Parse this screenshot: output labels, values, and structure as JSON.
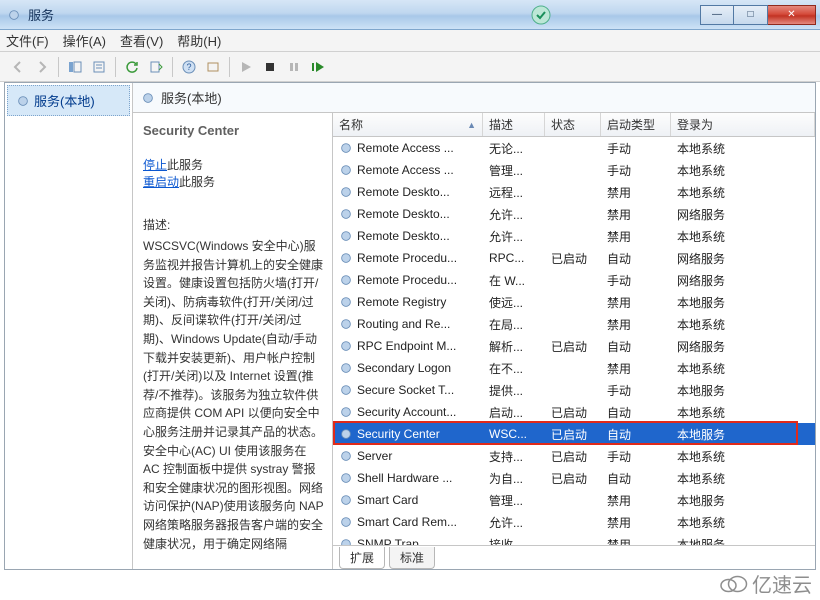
{
  "window": {
    "title": "服务",
    "buttons": {
      "min": "—",
      "max": "□",
      "close": "✕"
    }
  },
  "menu": {
    "file": "文件(F)",
    "action": "操作(A)",
    "view": "查看(V)",
    "help": "帮助(H)"
  },
  "tree": {
    "root_label": "服务(本地)"
  },
  "right_header": {
    "title": "服务(本地)"
  },
  "details": {
    "service_name": "Security Center",
    "stop_link": "停止",
    "stop_tail": "此服务",
    "restart_link": "重启动",
    "restart_tail": "此服务",
    "desc_label": "描述:",
    "desc_text": "WSCSVC(Windows 安全中心)服务监视并报告计算机上的安全健康设置。健康设置包括防火墙(打开/关闭)、防病毒软件(打开/关闭/过期)、反间谍软件(打开/关闭/过期)、Windows Update(自动/手动下载并安装更新)、用户帐户控制(打开/关闭)以及 Internet 设置(推荐/不推荐)。该服务为独立软件供应商提供 COM API 以便向安全中心服务注册并记录其产品的状态。安全中心(AC) UI 使用该服务在 AC 控制面板中提供 systray 警报和安全健康状况的图形视图。网络访问保护(NAP)使用该服务向 NAP 网络策略服务器报告客户端的安全健康状况，用于确定网络隔"
  },
  "list": {
    "columns": {
      "name": "名称",
      "desc": "描述",
      "state": "状态",
      "start": "启动类型",
      "logon": "登录为"
    },
    "rows": [
      {
        "name": "Remote Access ...",
        "desc": "无论...",
        "state": "",
        "start": "手动",
        "logon": "本地系统"
      },
      {
        "name": "Remote Access ...",
        "desc": "管理...",
        "state": "",
        "start": "手动",
        "logon": "本地系统"
      },
      {
        "name": "Remote Deskto...",
        "desc": "远程...",
        "state": "",
        "start": "禁用",
        "logon": "本地系统"
      },
      {
        "name": "Remote Deskto...",
        "desc": "允许...",
        "state": "",
        "start": "禁用",
        "logon": "网络服务"
      },
      {
        "name": "Remote Deskto...",
        "desc": "允许...",
        "state": "",
        "start": "禁用",
        "logon": "本地系统"
      },
      {
        "name": "Remote Procedu...",
        "desc": "RPC...",
        "state": "已启动",
        "start": "自动",
        "logon": "网络服务"
      },
      {
        "name": "Remote Procedu...",
        "desc": "在 W...",
        "state": "",
        "start": "手动",
        "logon": "网络服务"
      },
      {
        "name": "Remote Registry",
        "desc": "使远...",
        "state": "",
        "start": "禁用",
        "logon": "本地服务"
      },
      {
        "name": "Routing and Re...",
        "desc": "在局...",
        "state": "",
        "start": "禁用",
        "logon": "本地系统"
      },
      {
        "name": "RPC Endpoint M...",
        "desc": "解析...",
        "state": "已启动",
        "start": "自动",
        "logon": "网络服务"
      },
      {
        "name": "Secondary Logon",
        "desc": "在不...",
        "state": "",
        "start": "禁用",
        "logon": "本地系统"
      },
      {
        "name": "Secure Socket T...",
        "desc": "提供...",
        "state": "",
        "start": "手动",
        "logon": "本地服务"
      },
      {
        "name": "Security Account...",
        "desc": "启动...",
        "state": "已启动",
        "start": "自动",
        "logon": "本地系统"
      },
      {
        "name": "Security Center",
        "desc": "WSC...",
        "state": "已启动",
        "start": "自动",
        "logon": "本地服务",
        "selected": true
      },
      {
        "name": "Server",
        "desc": "支持...",
        "state": "已启动",
        "start": "手动",
        "logon": "本地系统"
      },
      {
        "name": "Shell Hardware ...",
        "desc": "为自...",
        "state": "已启动",
        "start": "自动",
        "logon": "本地系统"
      },
      {
        "name": "Smart Card",
        "desc": "管理...",
        "state": "",
        "start": "禁用",
        "logon": "本地服务"
      },
      {
        "name": "Smart Card Rem...",
        "desc": "允许...",
        "state": "",
        "start": "禁用",
        "logon": "本地系统"
      },
      {
        "name": "SNMP Trap",
        "desc": "接收...",
        "state": "",
        "start": "禁用",
        "logon": "本地服务"
      }
    ],
    "highlight_row_index": 13
  },
  "tabs": {
    "extended": "扩展",
    "standard": "标准"
  },
  "watermark": "亿速云"
}
